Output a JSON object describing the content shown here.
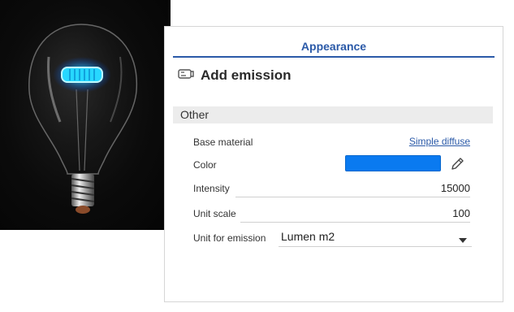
{
  "panel": {
    "title": "Appearance",
    "feature": {
      "icon": "emission-feature-icon",
      "title": "Add emission"
    },
    "section": "Other",
    "rows": {
      "base_material": {
        "label": "Base material",
        "value": "Simple diffuse"
      },
      "color": {
        "label": "Color",
        "swatch_color": "#0a7af0",
        "edit_icon": "pencil-icon"
      },
      "intensity": {
        "label": "Intensity",
        "value": "15000"
      },
      "unit_scale": {
        "label": "Unit scale",
        "value": "100"
      },
      "unit_for_emission": {
        "label": "Unit for emission",
        "value": "Lumen m2",
        "icon": "chevron-down-icon"
      }
    }
  },
  "colors": {
    "accent": "#2b5aa8",
    "emission": "#0a7af0",
    "section_bg": "#ececec"
  }
}
